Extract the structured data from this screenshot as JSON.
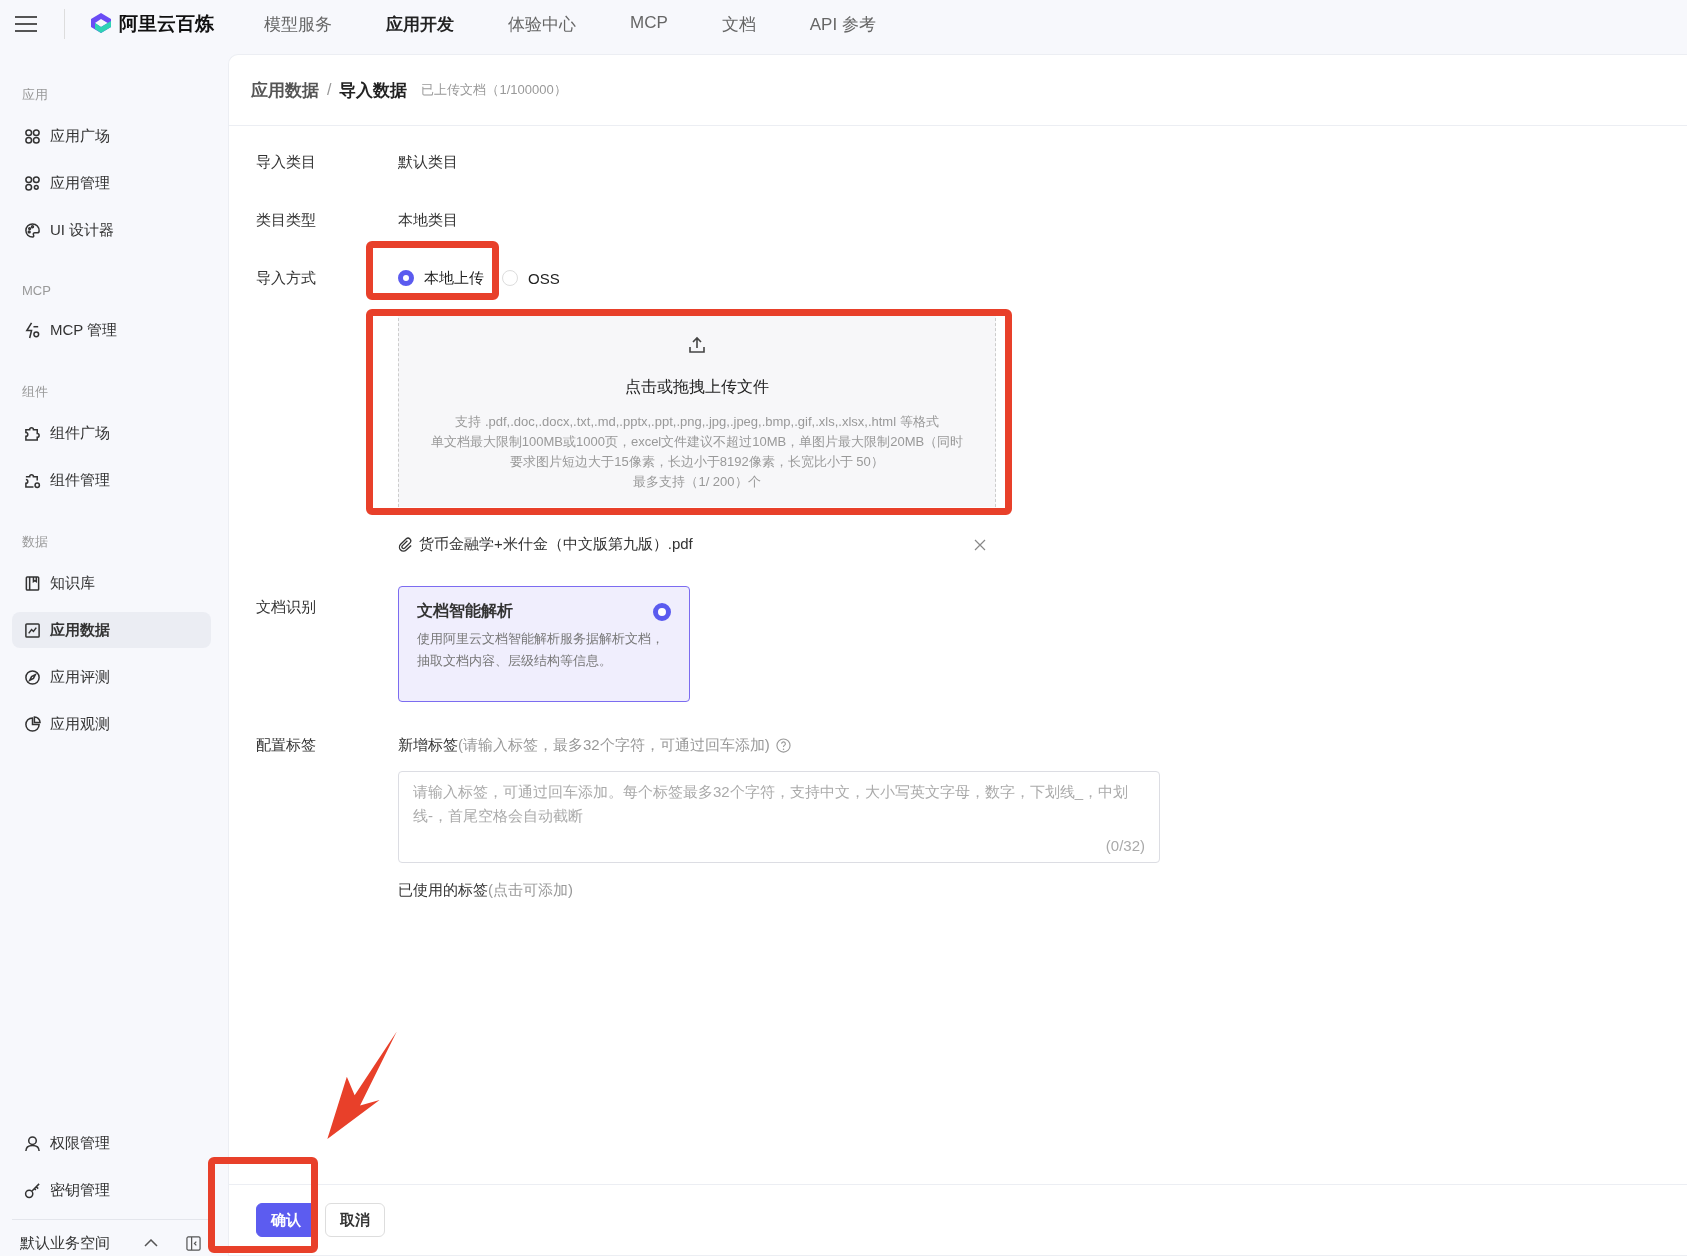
{
  "app": {
    "brand": "阿里云百炼"
  },
  "top_nav": [
    {
      "label": "模型服务",
      "selected": false
    },
    {
      "label": "应用开发",
      "selected": true
    },
    {
      "label": "体验中心",
      "selected": false
    },
    {
      "label": "MCP",
      "selected": false
    },
    {
      "label": "文档",
      "selected": false
    },
    {
      "label": "API 参考",
      "selected": false
    }
  ],
  "sidebar": {
    "sections": [
      {
        "title": "应用",
        "items": [
          {
            "label": "应用广场",
            "selected": false
          },
          {
            "label": "应用管理",
            "selected": false
          },
          {
            "label": "UI 设计器",
            "selected": false
          }
        ]
      },
      {
        "title": "MCP",
        "items": [
          {
            "label": "MCP 管理",
            "selected": false
          }
        ]
      },
      {
        "title": "组件",
        "items": [
          {
            "label": "组件广场",
            "selected": false
          },
          {
            "label": "组件管理",
            "selected": false
          }
        ]
      },
      {
        "title": "数据",
        "items": [
          {
            "label": "知识库",
            "selected": false
          },
          {
            "label": "应用数据",
            "selected": true
          },
          {
            "label": "应用评测",
            "selected": false
          },
          {
            "label": "应用观测",
            "selected": false
          }
        ]
      }
    ],
    "bottom_items": [
      {
        "label": "权限管理",
        "selected": false
      },
      {
        "label": "密钥管理",
        "selected": false
      }
    ],
    "workspace": "默认业务空间"
  },
  "breadcrumb": [
    "应用数据",
    "导入数据"
  ],
  "breadcrumb_separator": "/",
  "upload_count": "已上传文档（1/100000）",
  "form": {
    "info_rows": [
      {
        "label": "导入类目",
        "value": "默认类目"
      },
      {
        "label": "类目类型",
        "value": "本地类目"
      }
    ],
    "import_method": {
      "label": "导入方式",
      "options": [
        {
          "label": "本地上传",
          "selected": true
        },
        {
          "label": "OSS",
          "selected": false
        }
      ]
    },
    "upload": {
      "title": "点击或拖拽上传文件",
      "lines": [
        "支持 .pdf,.doc,.docx,.txt,.md,.pptx,.ppt,.png,.jpg,.jpeg,.bmp,.gif,.xls,.xlsx,.html 等格式",
        "单文档最大限制100MB或1000页，excel文件建议不超过10MB，单图片最大限制20MB（同时",
        "要求图片短边大于15像素，长边小于8192像素，长宽比小于 50）",
        "最多支持（1/ 200）个"
      ]
    },
    "file": {
      "name": "货币金融学+米什金（中文版第九版）.pdf"
    },
    "recognition": {
      "label": "文档识别",
      "options": [
        {
          "title": "文档智能解析",
          "description": "使用阿里云文档智能解析服务据解析文档，抽取文档内容、层级结构等信息。",
          "selected": true
        }
      ]
    },
    "tags": {
      "label": "配置标签",
      "add_label": "新增标签",
      "add_hint": "(请输入标签，最多32个字符，可通过回车添加)",
      "placeholder": "请输入标签，可通过回车添加。每个标签最多32个字符，支持中文，大小写英文字母，数字，下划线_，中划线-，首尾空格会自动截断",
      "counter": "(0/32)",
      "used_label": "已使用的标签",
      "used_hint": "(点击可添加)"
    }
  },
  "buttons": [
    {
      "label": "确认",
      "kind": "primary"
    },
    {
      "label": "取消",
      "kind": "default"
    }
  ]
}
